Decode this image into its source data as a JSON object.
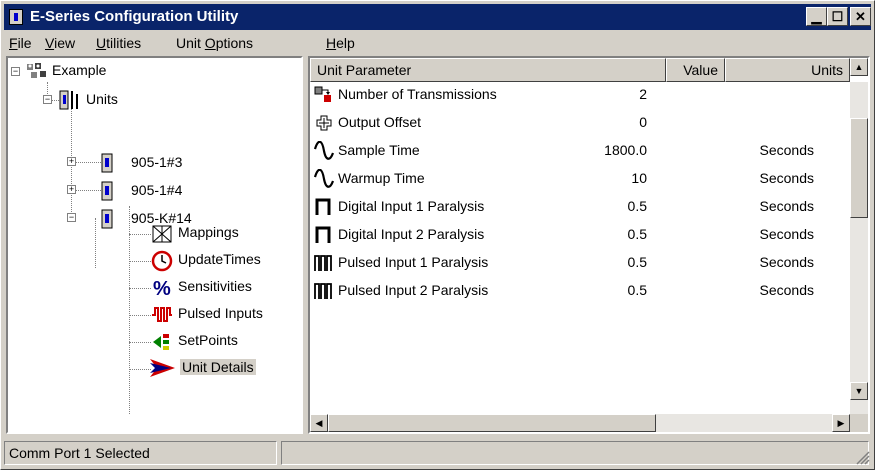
{
  "window": {
    "title": "E-Series Configuration Utility"
  },
  "menu": [
    {
      "pre": "",
      "u": "F",
      "post": "ile"
    },
    {
      "pre": "",
      "u": "V",
      "post": "iew"
    },
    {
      "pre": "",
      "u": "U",
      "post": "tilities"
    },
    {
      "pre": "Unit ",
      "u": "O",
      "post": "ptions"
    },
    {
      "pre": "",
      "u": "H",
      "post": "elp"
    }
  ],
  "tree": {
    "root": "Example",
    "units": "Units",
    "unit1": "905-1#3",
    "unit2": "905-1#4",
    "unit3": "905-K#14",
    "children": [
      "Mappings",
      "UpdateTimes",
      "Sensitivities",
      "Pulsed Inputs",
      "SetPoints",
      "Unit Details"
    ]
  },
  "list": {
    "columns": {
      "param": "Unit Parameter",
      "value": "Value",
      "units": "Units"
    },
    "rows": [
      {
        "param": "Number of Transmissions",
        "value": "2",
        "units": "",
        "icon": "transmissions-icon"
      },
      {
        "param": "Output Offset",
        "value": "0",
        "units": "",
        "icon": "plus-offset-icon"
      },
      {
        "param": "Sample Time",
        "value": "1800.0",
        "units": "Seconds",
        "icon": "wave-icon"
      },
      {
        "param": "Warmup Time",
        "value": "10",
        "units": "Seconds",
        "icon": "wave-icon"
      },
      {
        "param": "Digital Input 1 Paralysis",
        "value": "0.5",
        "units": "Seconds",
        "icon": "digital-pulse-icon"
      },
      {
        "param": "Digital Input 2 Paralysis",
        "value": "0.5",
        "units": "Seconds",
        "icon": "digital-pulse-icon"
      },
      {
        "param": "Pulsed Input 1 Paralysis",
        "value": "0.5",
        "units": "Seconds",
        "icon": "pulse-train-icon"
      },
      {
        "param": "Pulsed Input 2 Paralysis",
        "value": "0.5",
        "units": "Seconds",
        "icon": "pulse-train-icon"
      }
    ]
  },
  "status": {
    "text": "Comm Port 1 Selected"
  },
  "colors": {
    "title_bg": "#0a246a",
    "face": "#d4d0c8"
  }
}
